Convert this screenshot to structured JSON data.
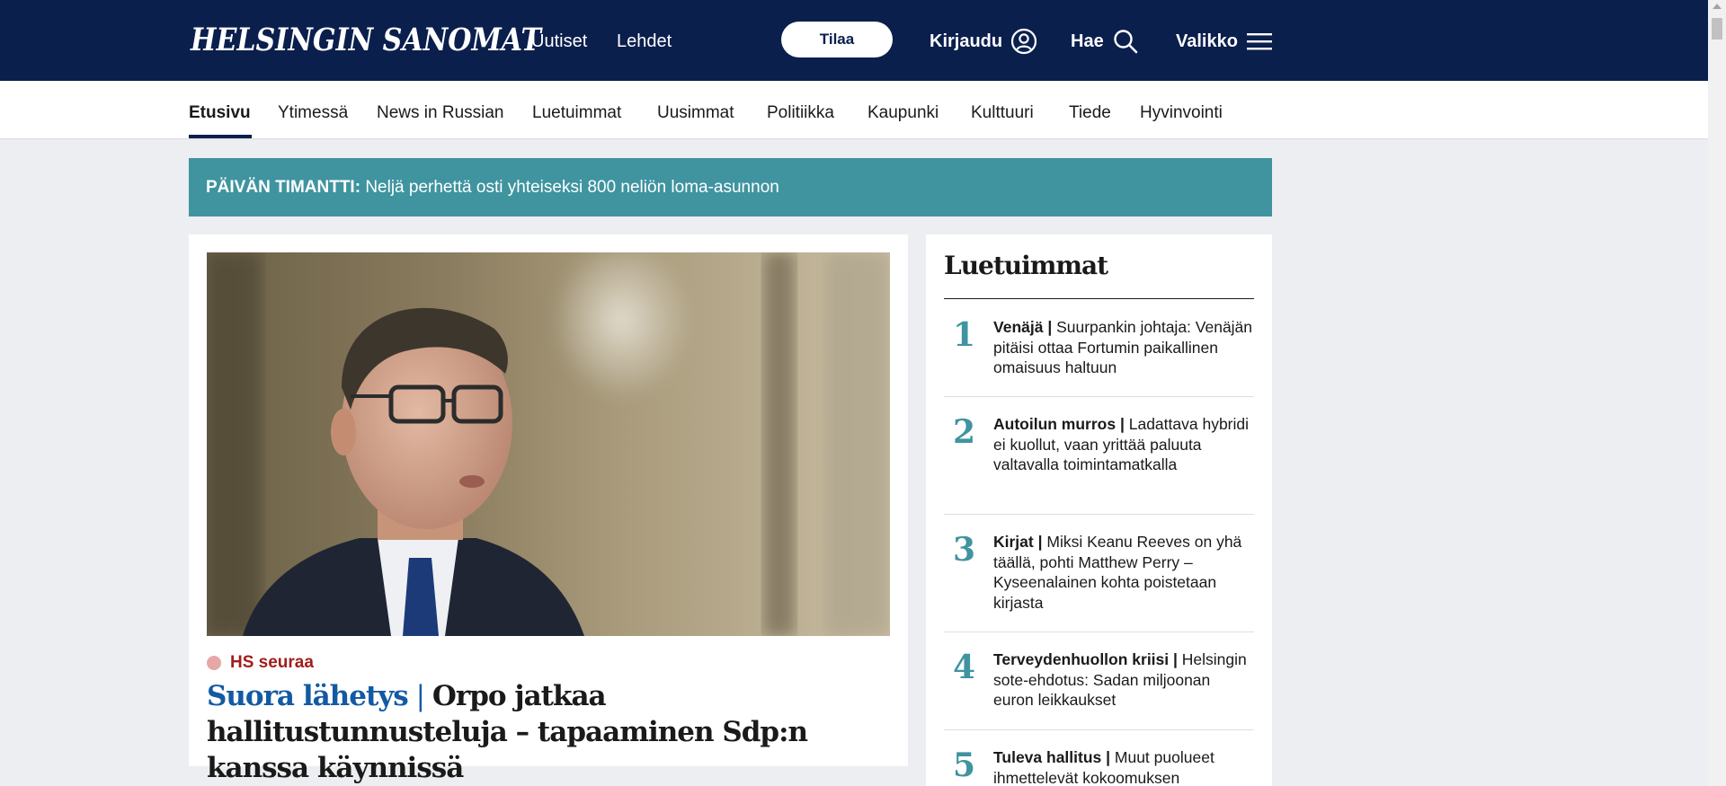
{
  "header": {
    "logo": "HELSINGIN SANOMAT",
    "links": [
      "Uutiset",
      "Lehdet"
    ],
    "subscribe": "Tilaa",
    "login": "Kirjaudu",
    "search": "Hae",
    "menu": "Valikko",
    "bg_color": "#0b1f4d"
  },
  "sections": {
    "tabs": [
      "Etusivu",
      "Ytimessä",
      "News in Russian",
      "Luetuimmat",
      "Uusimmat",
      "Politiikka",
      "Kaupunki",
      "Kulttuuri",
      "Tiede",
      "Hyvinvointi"
    ],
    "active": "Etusivu"
  },
  "banner": {
    "label": "PÄIVÄN TIMANTTI:",
    "text": " Neljä perhettä osti yhteiseksi 800 neliön loma-asunnon",
    "bg_color": "#3f94a0"
  },
  "lead": {
    "kicker": "HS seuraa",
    "tag": "Suora lähetys",
    "separator": " | ",
    "headline": "Orpo jatkaa hallitustunnusteluja – tapaaminen Sdp:n kanssa käynnissä"
  },
  "mostread": {
    "title": "Luetuimmat",
    "items": [
      {
        "rank": "1",
        "section": "Venäjä |",
        "title": " Suurpankin johtaja: Venäjän pitäisi ottaa Fortumin paikallinen omaisuus haltuun"
      },
      {
        "rank": "2",
        "section": "Autoilun murros |",
        "title": " Ladattava hybridi ei kuollut, vaan yrittää paluuta valtavalla toiminta­matkalla"
      },
      {
        "rank": "3",
        "section": "Kirjat |",
        "title": " Miksi Keanu Reeves on yhä täällä, pohti Matthew Perry – Kyseenalainen kohta poistetaan kirjasta"
      },
      {
        "rank": "4",
        "section": "Terveydenhuollon kriisi |",
        "title": " Helsingin sote-ehdotus: Sadan miljoonan euron leikkaukset"
      },
      {
        "rank": "5",
        "section": "Tuleva hallitus |",
        "title": " Muut puolueet ihmettelevät kokoomuksen"
      }
    ]
  },
  "colors": {
    "accent_teal": "#3f94a0",
    "live_blue": "#135aa3",
    "kicker_red": "#a11d1d"
  }
}
